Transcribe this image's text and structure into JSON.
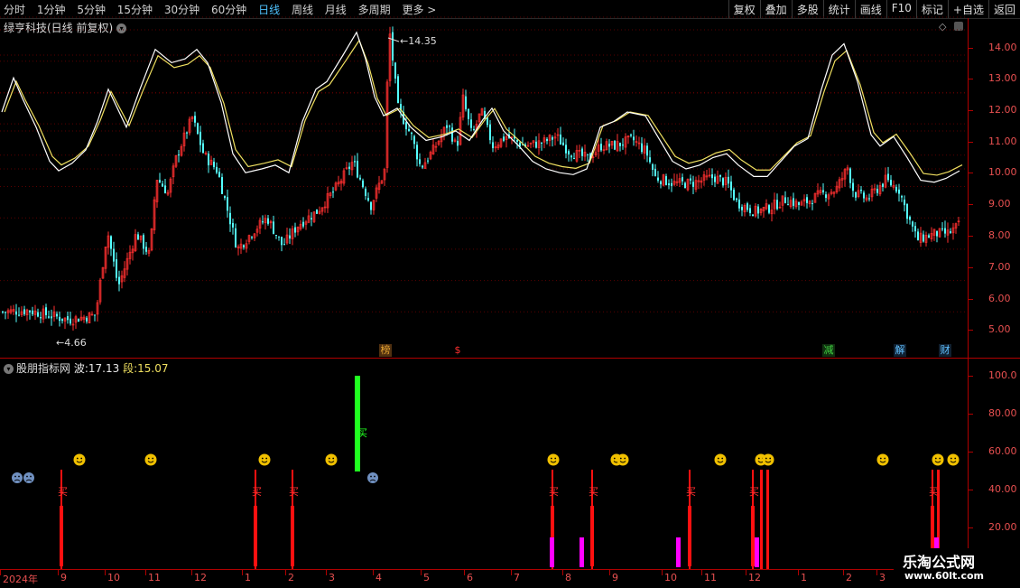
{
  "menu": {
    "periods": [
      "分时",
      "1分钟",
      "5分钟",
      "15分钟",
      "30分钟",
      "60分钟",
      "日线",
      "周线",
      "月线",
      "多周期",
      "更多 >"
    ],
    "active_period": "日线",
    "buttons": [
      "复权",
      "叠加",
      "多股",
      "统计",
      "画线",
      "F10",
      "标记",
      "+自选",
      "返回"
    ]
  },
  "chart_title": "绿亨科技(日线 前复权)",
  "price_axis": [
    "14.00",
    "13.00",
    "12.00",
    "11.00",
    "10.00",
    "9.00",
    "8.00",
    "7.00",
    "6.00",
    "5.00"
  ],
  "annotations": {
    "high": "14.35",
    "low": "4.66"
  },
  "event_markers": [
    {
      "label": "榜",
      "color": "#e0a030",
      "bg": "#503010"
    },
    {
      "label": "$",
      "color": "#ff3030",
      "bg": "transparent"
    },
    {
      "label": "减",
      "color": "#40d040",
      "bg": "#103010"
    },
    {
      "label": "解",
      "color": "#60c0ff",
      "bg": "#102030"
    },
    {
      "label": "财",
      "color": "#60c0ff",
      "bg": "#102030"
    }
  ],
  "indicator": {
    "name": "股朋指标网",
    "wave_label": "波:",
    "wave_value": "17.13",
    "segment_label": "段:",
    "segment_value": "15.07",
    "axis": [
      "100.0",
      "80.00",
      "60.00",
      "40.00",
      "20.00"
    ],
    "buy_label": "买"
  },
  "date_axis": [
    "2024年",
    "9",
    "10",
    "11",
    "12",
    "1",
    "2",
    "3",
    "4",
    "5",
    "6",
    "7",
    "8",
    "9",
    "10",
    "11",
    "12",
    "1",
    "2",
    "3"
  ],
  "watermark": {
    "title": "乐淘公式网",
    "url": "www.60lt.com"
  },
  "colors": {
    "up": "#ff3030",
    "down": "#54ffff",
    "wave": "#ffffff",
    "segment": "#f0e060",
    "buy_bar": "#ff1010",
    "magenta": "#ff00ff",
    "green": "#20ff20"
  }
}
